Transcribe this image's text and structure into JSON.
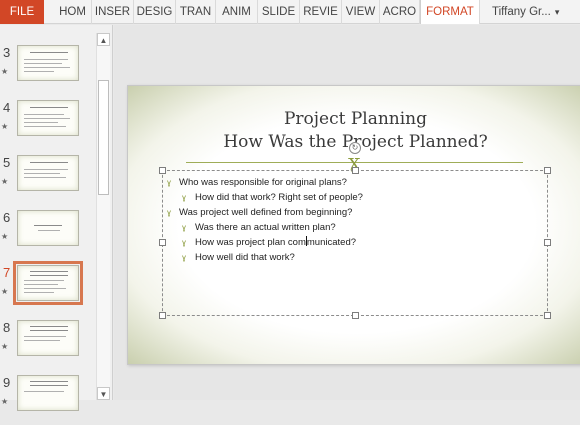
{
  "ribbon": {
    "tabs": [
      {
        "label": "FILE",
        "kind": "file"
      },
      {
        "label": "HOM",
        "kind": "tab"
      },
      {
        "label": "INSER",
        "kind": "tab"
      },
      {
        "label": "DESIG",
        "kind": "tab"
      },
      {
        "label": "TRAN",
        "kind": "tab"
      },
      {
        "label": "ANIM",
        "kind": "tab"
      },
      {
        "label": "SLIDE",
        "kind": "tab"
      },
      {
        "label": "REVIE",
        "kind": "tab"
      },
      {
        "label": "VIEW",
        "kind": "tab"
      },
      {
        "label": "ACRO",
        "kind": "tab"
      },
      {
        "label": "FORMAT",
        "kind": "contextual"
      }
    ],
    "user_name": "Tiffany Gr..."
  },
  "thumbnails": {
    "items": [
      {
        "number": "3",
        "active": false
      },
      {
        "number": "4",
        "active": false
      },
      {
        "number": "5",
        "active": false
      },
      {
        "number": "6",
        "active": false
      },
      {
        "number": "7",
        "active": true
      },
      {
        "number": "8",
        "active": false
      },
      {
        "number": "9",
        "active": false
      }
    ],
    "star": "★",
    "scroll_up": "▲",
    "scroll_down": "▼"
  },
  "slide": {
    "title_line1": "Project Planning",
    "title_line2": "How Was the Project Planned?",
    "ornament": "ɣ",
    "bullets": [
      {
        "level": 1,
        "text": "Who was responsible for original plans?"
      },
      {
        "level": 2,
        "text": "How did that work? Right set of people?"
      },
      {
        "level": 1,
        "text": "Was project well defined from beginning?"
      },
      {
        "level": 2,
        "text": "Was there an actual written plan?"
      },
      {
        "level": 2,
        "text_before_cursor": "How was project plan com",
        "text_after_cursor": "municated?"
      },
      {
        "level": 2,
        "text": "How well did that work?"
      }
    ],
    "bullet_glyph": "ɣ",
    "accent_color": "#8c9c3e"
  },
  "colors": {
    "file_tab": "#d24726",
    "active_thumb_outline": "#d7774f"
  }
}
